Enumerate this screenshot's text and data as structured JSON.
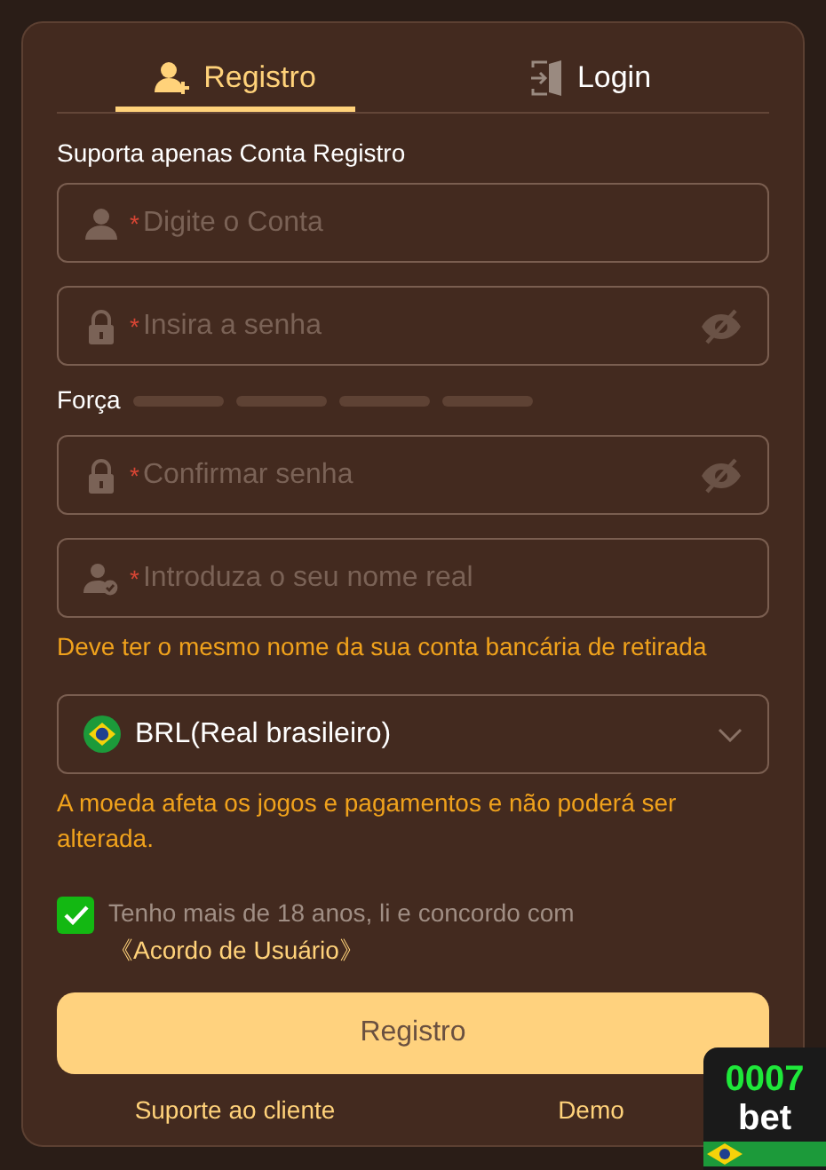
{
  "tabs": [
    {
      "label": "Registro",
      "kind": "register",
      "selected": true
    },
    {
      "label": "Login",
      "kind": "login",
      "selected": false
    }
  ],
  "account_label": "Suporta apenas Conta Registro",
  "fields": [
    {
      "kind": "user",
      "required_mark": "*",
      "placeholder": "Digite o Conta"
    },
    {
      "kind": "password",
      "required_mark": "*",
      "placeholder": "Insira a senha"
    },
    {
      "kind": "strength",
      "label": "Força"
    },
    {
      "kind": "password",
      "required_mark": "*",
      "placeholder": "Confirmar senha"
    },
    {
      "kind": "name",
      "required_mark": "*",
      "placeholder": "Introduza o seu nome real",
      "hint": "Deve ter o mesmo nome da sua conta bancária de retirada"
    }
  ],
  "currency": {
    "value": "BRL(Real brasileiro)",
    "hint": "A moeda afeta os jogos e pagamentos e não poderá ser alterada."
  },
  "agreement": {
    "checked": true,
    "text": "Tenho mais de 18 anos, li e concordo com ",
    "link": "《Acordo de Usuário》"
  },
  "submit": "Registro",
  "footer_links": [
    "Suporte ao cliente",
    "Demo"
  ],
  "badge": {
    "number": "0007",
    "word": "bet"
  }
}
